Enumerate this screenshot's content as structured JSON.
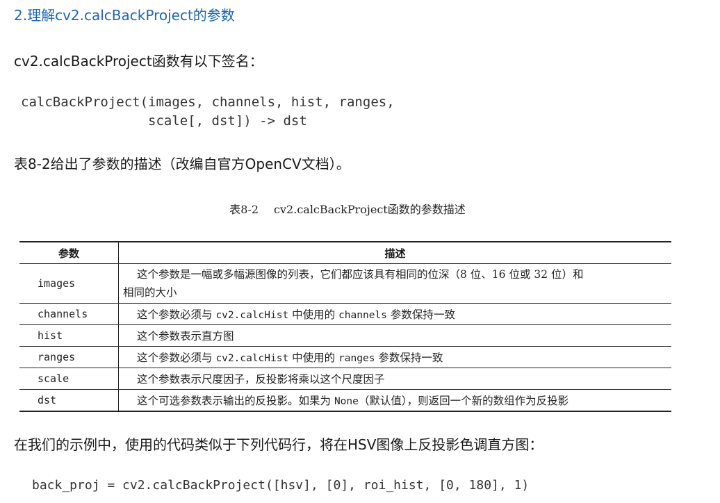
{
  "heading": "2.理解cv2.calcBackProject的参数",
  "intro": "cv2.calcBackProject函数有以下签名：",
  "signature": {
    "line1": "calcBackProject(images, channels, hist, ranges,",
    "line2": "                scale[, dst]) -> dst"
  },
  "table_intro": "表8-2给出了参数的描述（改编自官方OpenCV文档）。",
  "caption": {
    "number": "表8-2",
    "title": "cv2.calcBackProject函数的参数描述"
  },
  "table": {
    "headers": [
      "参数",
      "描述"
    ],
    "rows": [
      {
        "param": "images",
        "desc_a": "这个参数是一幅或多幅源图像的列表，它们都应该具有相同的位深（8 位、16 位或 32 位）和",
        "desc_b": "相同的大小"
      },
      {
        "param": "channels",
        "pre": "这个参数必须与 ",
        "code1": "cv2.calcHist",
        "mid": " 中使用的 ",
        "code2": "channels",
        "post": " 参数保持一致"
      },
      {
        "param": "hist",
        "desc": "这个参数表示直方图"
      },
      {
        "param": "ranges",
        "pre": "这个参数必须与 ",
        "code1": "cv2.calcHist",
        "mid": " 中使用的 ",
        "code2": "ranges",
        "post": " 参数保持一致"
      },
      {
        "param": "scale",
        "desc": "这个参数表示尺度因子，反投影将乘以这个尺度因子"
      },
      {
        "param": "dst",
        "pre": "这个可选参数表示输出的反投影。如果为 ",
        "code1": "None",
        "post": "（默认值），则返回一个新的数组作为反投影"
      }
    ]
  },
  "example_intro": "在我们的示例中，使用的代码类似于下列代码行，将在HSV图像上反投影色调直方图：",
  "example_code": "back_proj = cv2.calcBackProject([hsv], [0], roi_hist, [0, 180], 1)"
}
